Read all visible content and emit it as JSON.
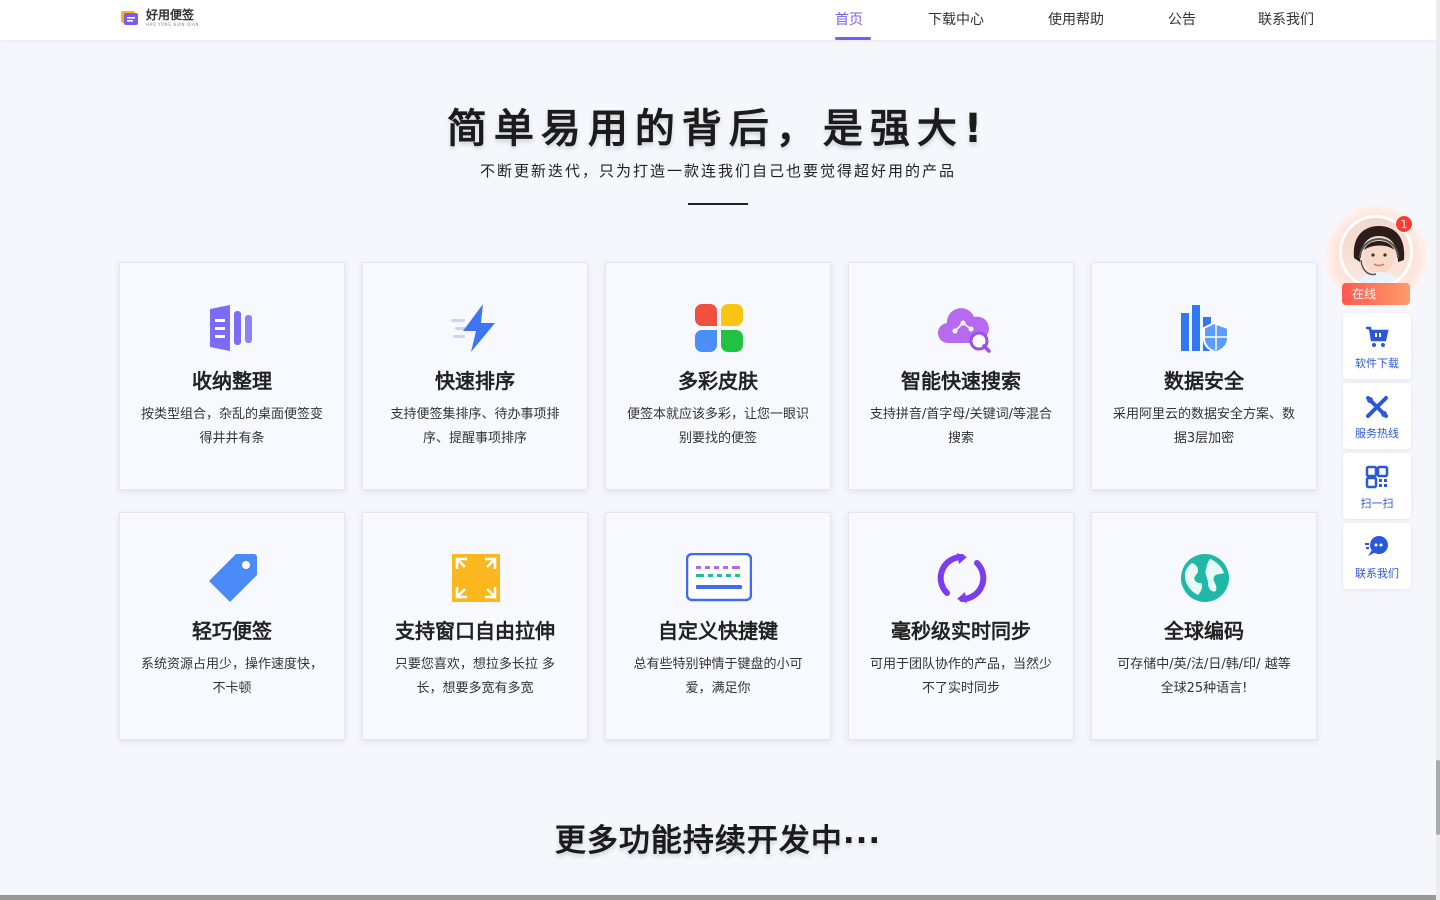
{
  "header": {
    "logo_title": "好用便签",
    "logo_sub": "HAO YONG BIAN QIAN",
    "nav": [
      {
        "label": "首页",
        "active": true
      },
      {
        "label": "下载中心",
        "active": false
      },
      {
        "label": "使用帮助",
        "active": false
      },
      {
        "label": "公告",
        "active": false
      },
      {
        "label": "联系我们",
        "active": false
      }
    ]
  },
  "hero": {
    "title": "简单易用的背后，是强大!",
    "subtitle": "不断更新迭代，只为打造一款连我们自己也要觉得超好用的产品"
  },
  "features": [
    {
      "title": "收纳整理",
      "desc": "按类型组合，杂乱的桌面便签变得井井有条",
      "icon": "organize-icon"
    },
    {
      "title": "快速排序",
      "desc": "支持便签集排序、待办事项排序、提醒事项排序",
      "icon": "lightning-icon"
    },
    {
      "title": "多彩皮肤",
      "desc": "便签本就应该多彩，让您一眼识别要找的便签",
      "icon": "clover-icon"
    },
    {
      "title": "智能快速搜索",
      "desc": "支持拼音/首字母/关键词/等混合搜索",
      "icon": "cloud-search-icon"
    },
    {
      "title": "数据安全",
      "desc": "采用阿里云的数据安全方案、数据3层加密",
      "icon": "shield-icon"
    },
    {
      "title": "轻巧便签",
      "desc": "系统资源占用少，操作速度快，不卡顿",
      "icon": "tag-icon"
    },
    {
      "title": "支持窗口自由拉伸",
      "desc": "只要您喜欢，想拉多长拉 多长，想要多宽有多宽",
      "icon": "resize-icon"
    },
    {
      "title": "自定义快捷键",
      "desc": "总有些特别钟情于键盘的小可爱，满足你",
      "icon": "keyboard-icon"
    },
    {
      "title": "毫秒级实时同步",
      "desc": "可用于团队协作的产品，当然少不了实时同步",
      "icon": "sync-icon"
    },
    {
      "title": "全球编码",
      "desc": "可存储中/英/法/日/韩/印/ 越等全球25种语言!",
      "icon": "globe-icon"
    }
  ],
  "more_text": "更多功能持续开发中···",
  "sidebar": {
    "badge_count": "1",
    "online_label": "在线",
    "buttons": [
      {
        "label": "软件下载",
        "icon": "cart-icon"
      },
      {
        "label": "服务热线",
        "icon": "tools-icon"
      },
      {
        "label": "扫一扫",
        "icon": "qrcode-icon"
      },
      {
        "label": "联系我们",
        "icon": "chat-icon"
      }
    ]
  },
  "colors": {
    "accent": "#7b5cf0",
    "side_text": "#2a58d8"
  }
}
